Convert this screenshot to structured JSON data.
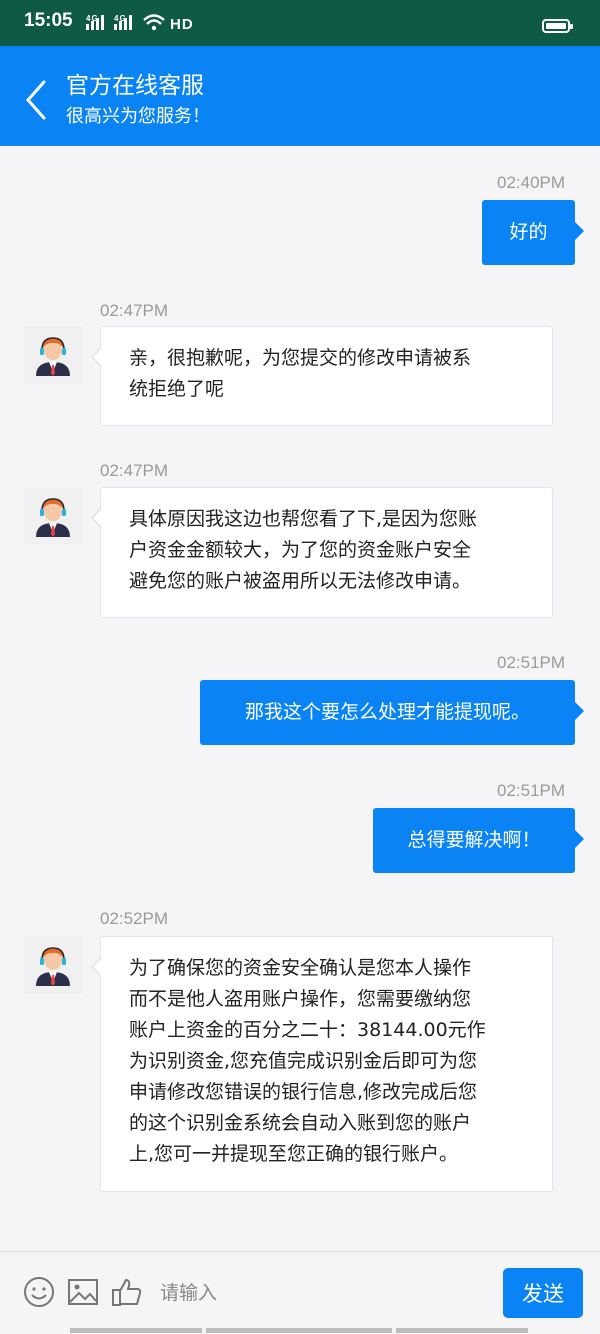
{
  "status_bar": {
    "time": "15:05",
    "signal_text": "4G▐ıl 4G▐ıl ≡ HD",
    "battery_level": 0.8
  },
  "header": {
    "title": "官方在线客服",
    "subtitle": "很高兴为您服务！"
  },
  "messages": [
    {
      "direction": "out",
      "time": "02:40PM",
      "lines": [
        "好的"
      ]
    },
    {
      "direction": "in",
      "time": "02:47PM",
      "lines": [
        "亲，很抱歉呢，为您提交的修改申请被系",
        "统拒绝了呢"
      ]
    },
    {
      "direction": "in",
      "time": "02:47PM",
      "lines": [
        "具体原因我这边也帮您看了下,是因为您账",
        "户资金金额较大，为了您的资金账户安全",
        "避免您的账户被盗用所以无法修改申请。"
      ]
    },
    {
      "direction": "out",
      "time": "02:51PM",
      "lines": [
        "那我这个要怎么处理才能提现呢。"
      ]
    },
    {
      "direction": "out",
      "time": "02:51PM",
      "lines": [
        "总得要解决啊！"
      ]
    },
    {
      "direction": "in",
      "time": "02:52PM",
      "lines": [
        "为了确保您的资金安全确认是您本人操作",
        "而不是他人盗用账户操作，您需要缴纳您",
        "账户上资金的百分之二十：38144.00元作",
        "为识别资金,您充值完成识别金后即可为您",
        "申请修改您错误的银行信息,修改完成后您",
        "的这个识别金系统会自动入账到您的账户",
        "上,您可一并提现至您正确的银行账户。"
      ]
    }
  ],
  "input_bar": {
    "icons": [
      "emoji-icon",
      "image-icon",
      "thumbs-up-icon"
    ],
    "placeholder": "请输入",
    "send_label": "发送"
  },
  "colors": {
    "accent": "#0a84f4",
    "status_bar": "#0e5a44",
    "background": "#f5f5f7"
  }
}
